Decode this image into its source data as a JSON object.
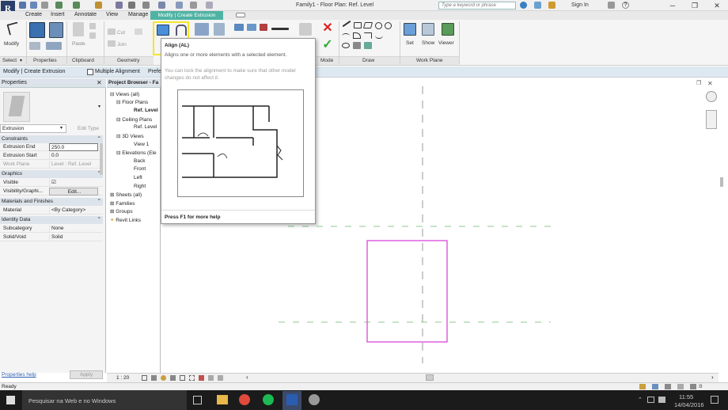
{
  "app": {
    "logo_letter": "R",
    "window_title": "Family1 - Floor Plan: Ref. Level",
    "search_placeholder": "Type a keyword or phrase",
    "sign_in": "Sign In",
    "help": "?"
  },
  "tabs": [
    "Create",
    "Insert",
    "Annotate",
    "View",
    "Manage"
  ],
  "active_tab": "Modify | Create Extrusion",
  "ribbon": {
    "modify_label": "Modify",
    "paste_label": "Paste",
    "cut_label": "Cut",
    "join_label": "Join",
    "set_label": "Set",
    "show_label": "Show",
    "viewer_label": "Viewer",
    "panels": {
      "select": "Select",
      "properties": "Properties",
      "clipboard": "Clipboard",
      "geometry": "Geometry",
      "mode": "Mode",
      "draw": "Draw",
      "work_plane": "Work Plane"
    }
  },
  "options_bar": {
    "context": "Modify | Create Extrusion",
    "multiple_alignment": "Multiple Alignment",
    "prefer": "Prefe"
  },
  "tooltip": {
    "title": "Align (AL)",
    "desc1": "Aligns one or more elements with a selected element.",
    "desc2": "You can lock the alignment to make sure that other model changes do not affect it.",
    "footer": "Press F1 for more help"
  },
  "properties": {
    "title": "Properties",
    "type": "Extrusion",
    "edit_type": "Edit Type",
    "sections": {
      "constraints": "Constraints",
      "graphics": "Graphics",
      "materials": "Materials and Finishes",
      "identity": "Identity Data"
    },
    "rows": {
      "extrusion_end": {
        "k": "Extrusion End",
        "v": "250.0"
      },
      "extrusion_start": {
        "k": "Extrusion Start",
        "v": "0.0"
      },
      "work_plane": {
        "k": "Work Plane",
        "v": "Level : Ref. Level"
      },
      "visible": {
        "k": "Visible",
        "v": "☑"
      },
      "visibility": {
        "k": "Visibility/Graphi...",
        "v": "Edit..."
      },
      "material": {
        "k": "Material",
        "v": "<By Category>"
      },
      "subcategory": {
        "k": "Subcategory",
        "v": "None"
      },
      "solid_void": {
        "k": "Solid/Void",
        "v": "Solid"
      }
    },
    "help_link": "Properties help",
    "apply": "Apply"
  },
  "browser": {
    "title": "Project Browser - Fa",
    "items": {
      "views": "Views (all)",
      "floor_plans": "Floor Plans",
      "ref_level_fp": "Ref. Level",
      "ceiling_plans": "Ceiling Plans",
      "ref_level_cp": "Ref. Level",
      "views3d": "3D Views",
      "view1": "View 1",
      "elevations": "Elevations (Ele",
      "back": "Back",
      "front": "Front",
      "left": "Left",
      "right": "Right",
      "sheets": "Sheets (all)",
      "families": "Families",
      "groups": "Groups",
      "links": "Revit Links"
    }
  },
  "viewbar": {
    "scale": "1 : 20"
  },
  "status": {
    "ready": "Ready",
    "counter": ":0"
  },
  "taskbar": {
    "search": "Pesquisar na Web e no Windows",
    "time": "11:55",
    "date": "14/04/2016"
  },
  "colors": {
    "accent": "#4fb3a4",
    "highlight": "#f5e52a",
    "magenta": "#d63ad6",
    "ref_plane": "#8fc98f"
  }
}
